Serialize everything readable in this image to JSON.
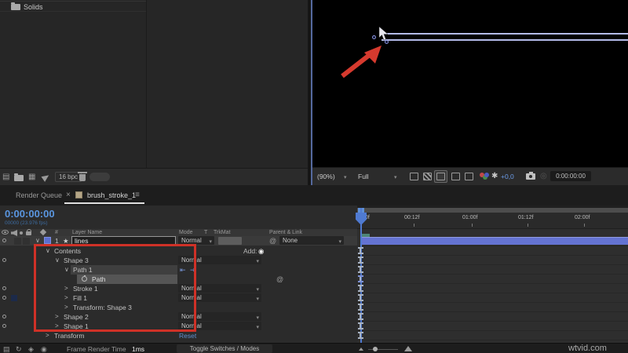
{
  "project": {
    "item_label": "Solids",
    "bpc_label": "16 bpc"
  },
  "viewer": {
    "zoom_value": "(90%)",
    "resolution_value": "Full",
    "offset_value": "+0,0",
    "timecode": "0:00:00:00"
  },
  "tabs": {
    "render_queue": "Render Queue",
    "comp_tab": "brush_stroke_1",
    "close": "×",
    "menu": "≡"
  },
  "timeline": {
    "timecode": "0:00:00:00",
    "frame_info": "00000 (23.976 fps)",
    "ruler_labels": [
      "0f",
      "00:12f",
      "01:00f",
      "01:12f",
      "02:00f"
    ],
    "columns": {
      "num": "#",
      "layer_name": "Layer Name",
      "mode": "Mode",
      "t": "T",
      "trkmat": "TrkMat",
      "parent": "Parent & Link"
    },
    "layer": {
      "num": "1",
      "name": "lines",
      "mode": "Normal",
      "parent": "None"
    },
    "add_label": "Add:",
    "reset_label": "Reset",
    "rows": [
      {
        "label": "Contents",
        "mode": ""
      },
      {
        "label": "Shape 3",
        "mode": "Normal"
      },
      {
        "label": "Path 1",
        "mode": ""
      },
      {
        "label": "Path",
        "mode": ""
      },
      {
        "label": "Stroke 1",
        "mode": "Normal"
      },
      {
        "label": "Fill 1",
        "mode": "Normal"
      },
      {
        "label": "Transform: Shape 3",
        "mode": ""
      },
      {
        "label": "Shape 2",
        "mode": "Normal"
      },
      {
        "label": "Shape 1",
        "mode": "Normal"
      },
      {
        "label": "Transform",
        "mode": ""
      }
    ]
  },
  "status": {
    "frame_render_label": "Frame Render Time",
    "frame_render_value": "1ms",
    "toggle_label": "Toggle Switches / Modes"
  },
  "watermark": "wtvid.com",
  "colors": {
    "accent_blue": "#4f7ad1",
    "layer_bar_blue": "#6473d2",
    "annotation_red": "#cf3127",
    "shape_stroke": "#b3bae8"
  }
}
